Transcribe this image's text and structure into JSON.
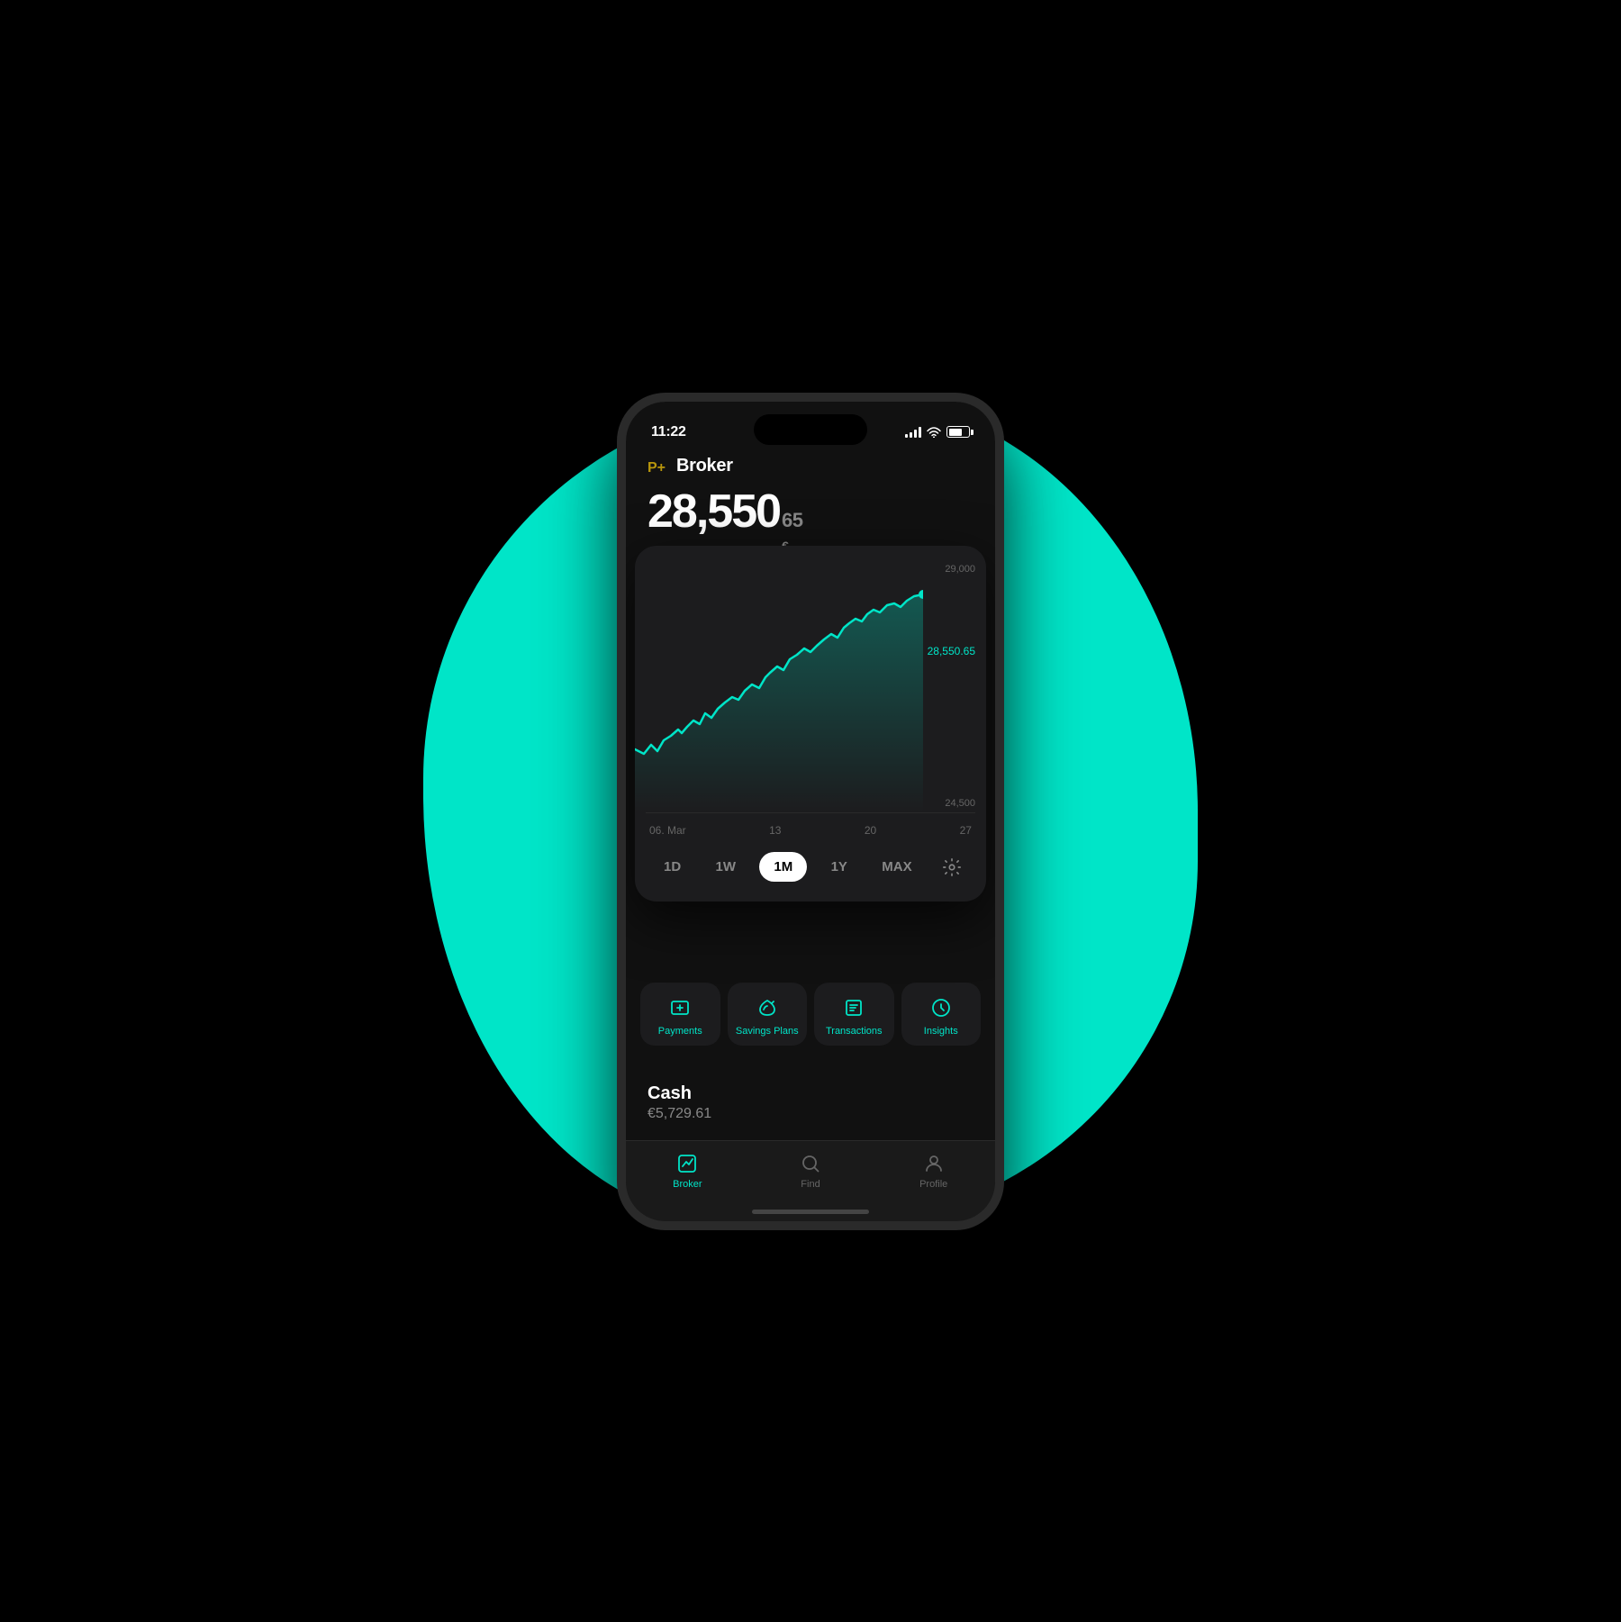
{
  "background": {
    "teal_color": "#00e5c8"
  },
  "status_bar": {
    "time": "11:22",
    "signal_label": "signal",
    "wifi_label": "wifi",
    "battery_label": "battery"
  },
  "header": {
    "brand_symbol": "P+",
    "brand_name": "Broker",
    "portfolio_main": "28,550",
    "portfolio_cents": "65",
    "portfolio_currency": "€"
  },
  "chart": {
    "y_labels": [
      "29,000",
      "28,550.65",
      "",
      "24,500"
    ],
    "current_value": "28,550.65",
    "x_labels": [
      "06. Mar",
      "13",
      "20",
      "27"
    ],
    "gradient_start": "#00e5c8",
    "gradient_end": "rgba(0,229,200,0)"
  },
  "period_selector": {
    "buttons": [
      {
        "label": "1D",
        "active": false
      },
      {
        "label": "1W",
        "active": false
      },
      {
        "label": "1M",
        "active": true
      },
      {
        "label": "1Y",
        "active": false
      },
      {
        "label": "MAX",
        "active": false
      }
    ],
    "settings_label": "settings"
  },
  "quick_actions": [
    {
      "label": "Payments",
      "icon": "payments-icon"
    },
    {
      "label": "Savings Plans",
      "icon": "savings-icon"
    },
    {
      "label": "Transactions",
      "icon": "transactions-icon"
    },
    {
      "label": "Insights",
      "icon": "insights-icon"
    }
  ],
  "cash": {
    "title": "Cash",
    "value": "€5,729.61"
  },
  "bottom_nav": [
    {
      "label": "Broker",
      "icon": "chart-icon",
      "active": true
    },
    {
      "label": "Find",
      "icon": "search-icon",
      "active": false
    },
    {
      "label": "Profile",
      "icon": "profile-icon",
      "active": false
    }
  ]
}
